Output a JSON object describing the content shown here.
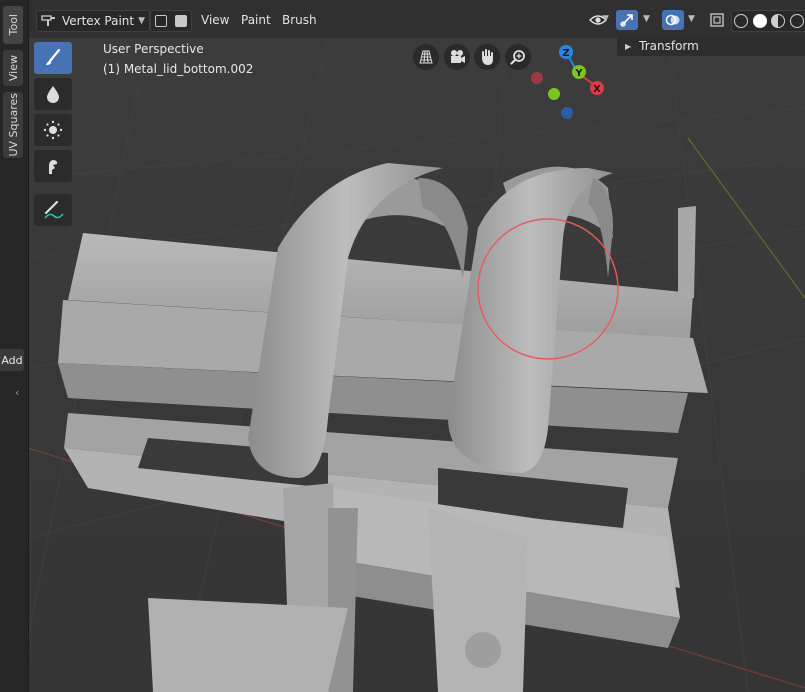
{
  "sidebar": {
    "tabs": [
      {
        "label": "Tool"
      },
      {
        "label": "View"
      },
      {
        "label": "UV Squares"
      }
    ],
    "add_label": "Add"
  },
  "header": {
    "mode": "Vertex Paint",
    "menus": [
      "View",
      "Paint",
      "Brush"
    ]
  },
  "viewport": {
    "perspective": "User Perspective",
    "object": "(1) Metal_lid_bottom.002"
  },
  "gizmo": {
    "z": "Z",
    "y": "Y",
    "x": "X",
    "colors": {
      "x": "#e23a48",
      "y": "#7ac522",
      "z": "#2b86e0",
      "neg_x": "#9a3a44",
      "neg_z": "#2a5fa5"
    }
  },
  "n_panel": {
    "transform_label": "Transform"
  },
  "tools": [
    {
      "icon": "draw-brush-icon",
      "active": true
    },
    {
      "icon": "blur-drop-icon",
      "active": false
    },
    {
      "icon": "average-icon",
      "active": false
    },
    {
      "icon": "smear-icon",
      "active": false
    },
    {
      "icon": "annotate-icon",
      "active": false
    }
  ],
  "colors": {
    "accent": "#4772b3",
    "brush_circle": "#e85a5a"
  }
}
